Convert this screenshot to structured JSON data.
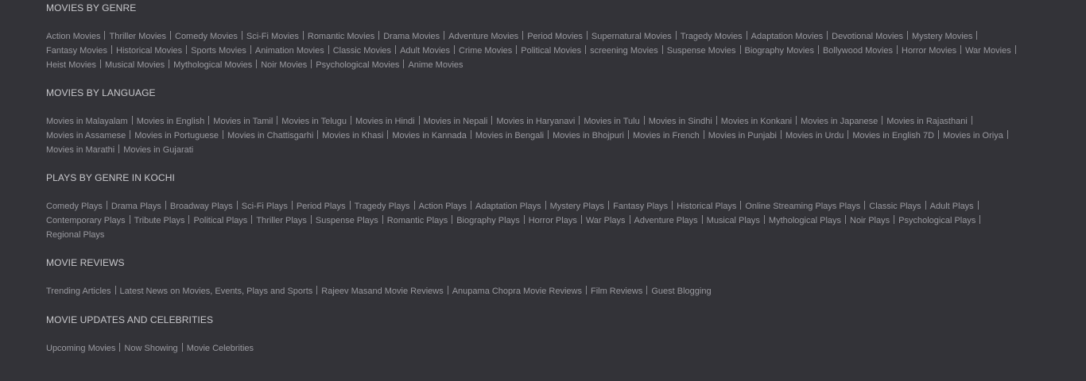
{
  "sections": [
    {
      "id": "sec-genre",
      "title": "MOVIES BY GENRE",
      "links": [
        "Action Movies",
        "Thriller Movies",
        "Comedy Movies",
        "Sci-Fi Movies",
        "Romantic Movies",
        "Drama Movies",
        "Adventure Movies",
        "Period Movies",
        "Supernatural Movies",
        "Tragedy Movies",
        "Adaptation Movies",
        "Devotional Movies",
        "Mystery Movies",
        "Fantasy Movies",
        "Historical Movies",
        "Sports Movies",
        "Animation Movies",
        "Classic Movies",
        "Adult Movies",
        "Crime Movies",
        "Political Movies",
        "screening Movies",
        "Suspense Movies",
        "Biography Movies",
        "Bollywood Movies",
        "Horror Movies",
        "War Movies",
        "Heist Movies",
        "Musical Movies",
        "Mythological Movies",
        "Noir Movies",
        "Psychological Movies",
        "Anime Movies"
      ]
    },
    {
      "id": "sec-language",
      "title": "MOVIES BY LANGUAGE",
      "links": [
        "Movies in Malayalam",
        "Movies in English",
        "Movies in Tamil",
        "Movies in Telugu",
        "Movies in Hindi",
        "Movies in Nepali",
        "Movies in Haryanavi",
        "Movies in Tulu",
        "Movies in Sindhi",
        "Movies in Konkani",
        "Movies in Japanese",
        "Movies in Rajasthani",
        "Movies in Assamese",
        "Movies in Portuguese",
        "Movies in Chattisgarhi",
        "Movies in Khasi",
        "Movies in Kannada",
        "Movies in Bengali",
        "Movies in Bhojpuri",
        "Movies in French",
        "Movies in Punjabi",
        "Movies in Urdu",
        "Movies in English 7D",
        "Movies in Oriya",
        "Movies in Marathi",
        "Movies in Gujarati"
      ]
    },
    {
      "id": "sec-plays",
      "title": "PLAYS BY GENRE IN KOCHI",
      "links": [
        "Comedy Plays",
        "Drama Plays",
        "Broadway Plays",
        "Sci-Fi Plays",
        "Period Plays",
        "Tragedy Plays",
        "Action Plays",
        "Adaptation Plays",
        "Mystery Plays",
        "Fantasy Plays",
        "Historical Plays",
        "Online Streaming Plays Plays",
        "Classic Plays",
        "Adult Plays",
        "Contemporary Plays",
        "Tribute Plays",
        "Political Plays",
        "Thriller Plays",
        "Suspense Plays",
        "Romantic Plays",
        "Biography Plays",
        "Horror Plays",
        "War Plays",
        "Adventure Plays",
        "Musical Plays",
        "Mythological Plays",
        "Noir Plays",
        "Psychological Plays",
        "Regional Plays"
      ]
    },
    {
      "id": "sec-reviews",
      "title": "MOVIE REVIEWS",
      "links": [
        "Trending Articles",
        "Latest News on Movies, Events, Plays and Sports",
        "Rajeev Masand Movie Reviews",
        "Anupama Chopra Movie Reviews",
        "Film Reviews",
        "Guest Blogging"
      ]
    },
    {
      "id": "sec-updates",
      "title": "MOVIE UPDATES AND CELEBRITIES",
      "links": [
        "Upcoming Movies",
        "Now Showing",
        "Movie Celebrities"
      ]
    }
  ]
}
